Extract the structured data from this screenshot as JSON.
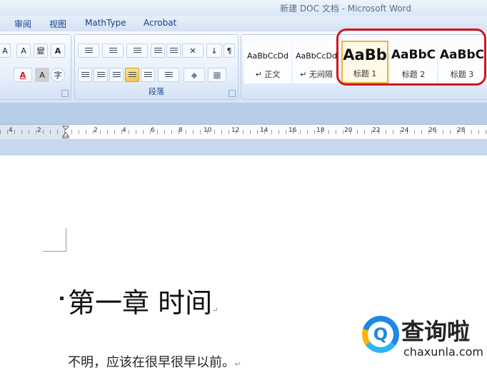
{
  "window": {
    "title": "新建 DOC 文档 - Microsoft Word"
  },
  "tabs": [
    "审阅",
    "视图",
    "MathType",
    "Acrobat"
  ],
  "ribbon": {
    "font_group": {
      "buttons": {
        "grow_font": "A",
        "phonetic_guide": "A",
        "change_case": "變",
        "char_border": "A",
        "font_color": "A",
        "char_shading": "A",
        "enclose_char": "字"
      }
    },
    "paragraph_group": {
      "label": "段落",
      "buttons": {
        "sort": "↓",
        "asian_layout": "✕"
      }
    },
    "styles_gallery": {
      "items": [
        {
          "sample": "AaBbCcDd",
          "name": "↵ 正文"
        },
        {
          "sample": "AaBbCcDd",
          "name": "↵ 无间隔"
        },
        {
          "sample": "AaBb",
          "name": "标题 1",
          "selected": true
        },
        {
          "sample": "AaBbC",
          "name": "标题 2"
        },
        {
          "sample": "AaBbC",
          "name": "标题 3"
        }
      ]
    }
  },
  "ruler": {
    "labels": [
      "4",
      "2",
      "2",
      "4",
      "6",
      "8",
      "10",
      "12",
      "14",
      "16",
      "18",
      "20",
      "22",
      "24",
      "26",
      "28"
    ]
  },
  "document": {
    "heading": "第一章  时间",
    "paragraph": "不明，应该在很早很早以前。",
    "paragraph_mark": "↵"
  },
  "watermark": {
    "name": "查询啦",
    "url": "chaxunla.com",
    "icon": "Q"
  },
  "colors": {
    "highlight": "#d0171b",
    "ribbon_blue": "#15428b",
    "selected_tile": "#e9b644"
  }
}
